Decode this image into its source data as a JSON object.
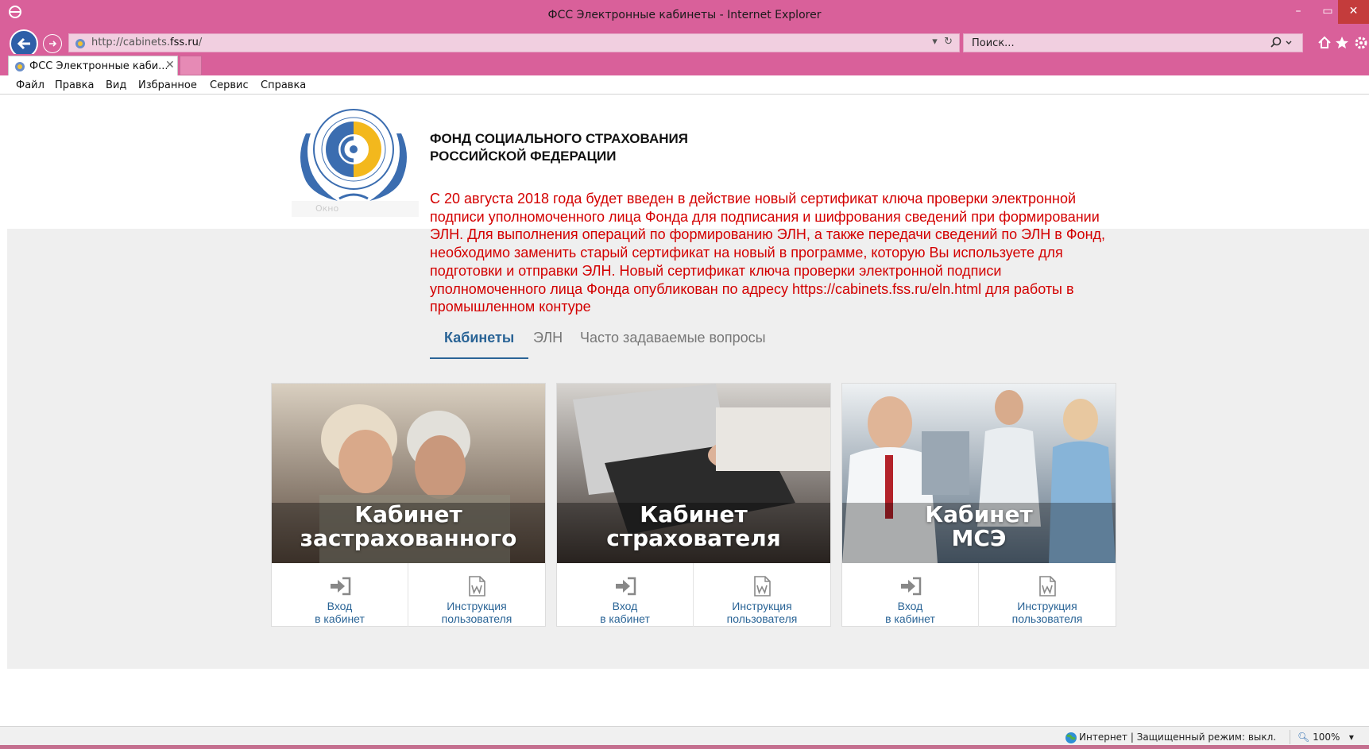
{
  "browser": {
    "window_title": "ФСС Электронные кабинеты - Internet Explorer",
    "url_prefix": "http://cabinets.",
    "url_domain": "fss.ru",
    "url_suffix": "/",
    "search_placeholder": "Поиск...",
    "tab_title": "ФСС Электронные каби...",
    "menu": [
      "Файл",
      "Правка",
      "Вид",
      "Избранное",
      "Сервис",
      "Справка"
    ],
    "icons": [
      "ie-logo-icon",
      "back-arrow-icon",
      "forward-arrow-icon",
      "refresh-icon",
      "search-icon",
      "home-icon",
      "star-icon",
      "gear-icon"
    ]
  },
  "header": {
    "org_line1": "ФОНД СОЦИАЛЬНОГО СТРАХОВАНИЯ",
    "org_line2": "РОССИЙСКОЙ ФЕДЕРАЦИИ",
    "emblem_faint": "Окно"
  },
  "notice": "С 20 августа 2018 года будет введен в действие новый сертификат ключа проверки электронной подписи уполномоченного лица Фонда для подписания и шифрования сведений при формировании ЭЛН. Для выполнения операций по формированию ЭЛН, а также передачи сведений по ЭЛН в Фонд, необходимо заменить старый сертификат на новый в программе, которую Вы используете для подготовки и отправки ЭЛН. Новый сертификат ключа проверки электронной подписи уполномоченного лица Фонда опубликован по адресу https://cabinets.fss.ru/eln.html для работы в промышленном контуре",
  "tabs": [
    "Кабинеты",
    "ЭЛН",
    "Часто задаваемые вопросы"
  ],
  "cards": [
    {
      "cap1": "Кабинет",
      "cap2": "застрахованного",
      "login1": "Вход",
      "login2": "в кабинет",
      "manual1": "Инструкция",
      "manual2": "пользователя"
    },
    {
      "cap1": "Кабинет",
      "cap2": "страхователя",
      "login1": "Вход",
      "login2": "в кабинет",
      "manual1": "Инструкция",
      "manual2": "пользователя"
    },
    {
      "cap1": "Кабинет",
      "cap2": "МСЭ",
      "login1": "Вход",
      "login2": "в кабинет",
      "manual1": "Инструкция",
      "manual2": "пользователя"
    }
  ],
  "status": {
    "zone": "Интернет | Защищенный режим: выкл.",
    "zoom": "100%"
  },
  "colors": {
    "chrome": "#d9609a",
    "notice": "#d30000",
    "link": "#2a6496"
  }
}
